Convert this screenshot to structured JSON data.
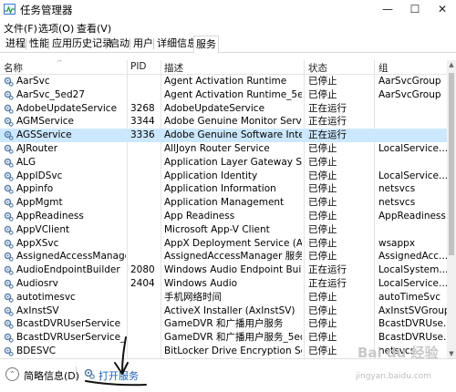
{
  "window": {
    "title": "任务管理器",
    "minimize": "—",
    "maximize": "☐",
    "close": "✕"
  },
  "menu": [
    "文件(F)",
    "选项(O)",
    "查看(V)"
  ],
  "tabs": [
    "进程",
    "性能",
    "应用历史记录",
    "启动",
    "用户",
    "详细信息",
    "服务"
  ],
  "active_tab": "服务",
  "columns": {
    "name": "名称",
    "pid": "PID",
    "desc": "描述",
    "status": "状态",
    "group": "组"
  },
  "rows": [
    {
      "name": "AarSvc",
      "pid": "",
      "desc": "Agent Activation Runtime",
      "status": "已停止",
      "group": "AarSvcGroup"
    },
    {
      "name": "AarSvc_5ed27",
      "pid": "",
      "desc": "Agent Activation Runtime_5ed27",
      "status": "已停止",
      "group": "AarSvcGroup"
    },
    {
      "name": "AdobeUpdateService",
      "pid": "3268",
      "desc": "AdobeUpdateService",
      "status": "正在运行",
      "group": ""
    },
    {
      "name": "AGMService",
      "pid": "3344",
      "desc": "Adobe Genuine Monitor Service",
      "status": "正在运行",
      "group": ""
    },
    {
      "name": "AGSService",
      "pid": "3336",
      "desc": "Adobe Genuine Software Integ...",
      "status": "正在运行",
      "group": ""
    },
    {
      "name": "AJRouter",
      "pid": "",
      "desc": "AllJoyn Router Service",
      "status": "已停止",
      "group": "LocalService..."
    },
    {
      "name": "ALG",
      "pid": "",
      "desc": "Application Layer Gateway Serv...",
      "status": "已停止",
      "group": ""
    },
    {
      "name": "AppIDSvc",
      "pid": "",
      "desc": "Application Identity",
      "status": "已停止",
      "group": "LocalService..."
    },
    {
      "name": "Appinfo",
      "pid": "",
      "desc": "Application Information",
      "status": "已停止",
      "group": "netsvcs"
    },
    {
      "name": "AppMgmt",
      "pid": "",
      "desc": "Application Management",
      "status": "已停止",
      "group": "netsvcs"
    },
    {
      "name": "AppReadiness",
      "pid": "",
      "desc": "App Readiness",
      "status": "已停止",
      "group": "AppReadiness"
    },
    {
      "name": "AppVClient",
      "pid": "",
      "desc": "Microsoft App-V Client",
      "status": "已停止",
      "group": ""
    },
    {
      "name": "AppXSvc",
      "pid": "",
      "desc": "AppX Deployment Service (Ap...",
      "status": "已停止",
      "group": "wsappx"
    },
    {
      "name": "AssignedAccessManager...",
      "pid": "",
      "desc": "AssignedAccessManager 服务",
      "status": "已停止",
      "group": "AssignedAcc..."
    },
    {
      "name": "AudioEndpointBuilder",
      "pid": "2080",
      "desc": "Windows Audio Endpoint Builder",
      "status": "正在运行",
      "group": "LocalSystem..."
    },
    {
      "name": "Audiosrv",
      "pid": "2404",
      "desc": "Windows Audio",
      "status": "正在运行",
      "group": "LocalService..."
    },
    {
      "name": "autotimesvc",
      "pid": "",
      "desc": "手机网络时间",
      "status": "已停止",
      "group": "autoTimeSvc"
    },
    {
      "name": "AxInstSV",
      "pid": "",
      "desc": "ActiveX Installer (AxInstSV)",
      "status": "已停止",
      "group": "AxInstSVGroup"
    },
    {
      "name": "BcastDVRUserService",
      "pid": "",
      "desc": "GameDVR 和广播用户服务",
      "status": "已停止",
      "group": "BcastDVRUse..."
    },
    {
      "name": "BcastDVRUserService_5e...",
      "pid": "",
      "desc": "GameDVR 和广播用户服务_5ed27",
      "status": "已停止",
      "group": "BcastDVRUse..."
    },
    {
      "name": "BDESVC",
      "pid": "",
      "desc": "BitLocker Drive Encryption Serv...",
      "status": "已停止",
      "group": "netsvcs"
    }
  ],
  "selected_row": "AGSService",
  "statusbar": {
    "brief": "简略信息(D)",
    "open_services": "打开服务",
    "collapse_glyph": "⌃"
  },
  "watermark": {
    "line1": "Bai du 经验",
    "line2": "jingyan.baidu.com"
  },
  "colors": {
    "selected_row": "#cce8ff",
    "link": "#1a5fb4",
    "gear": "#5a7fa8"
  }
}
